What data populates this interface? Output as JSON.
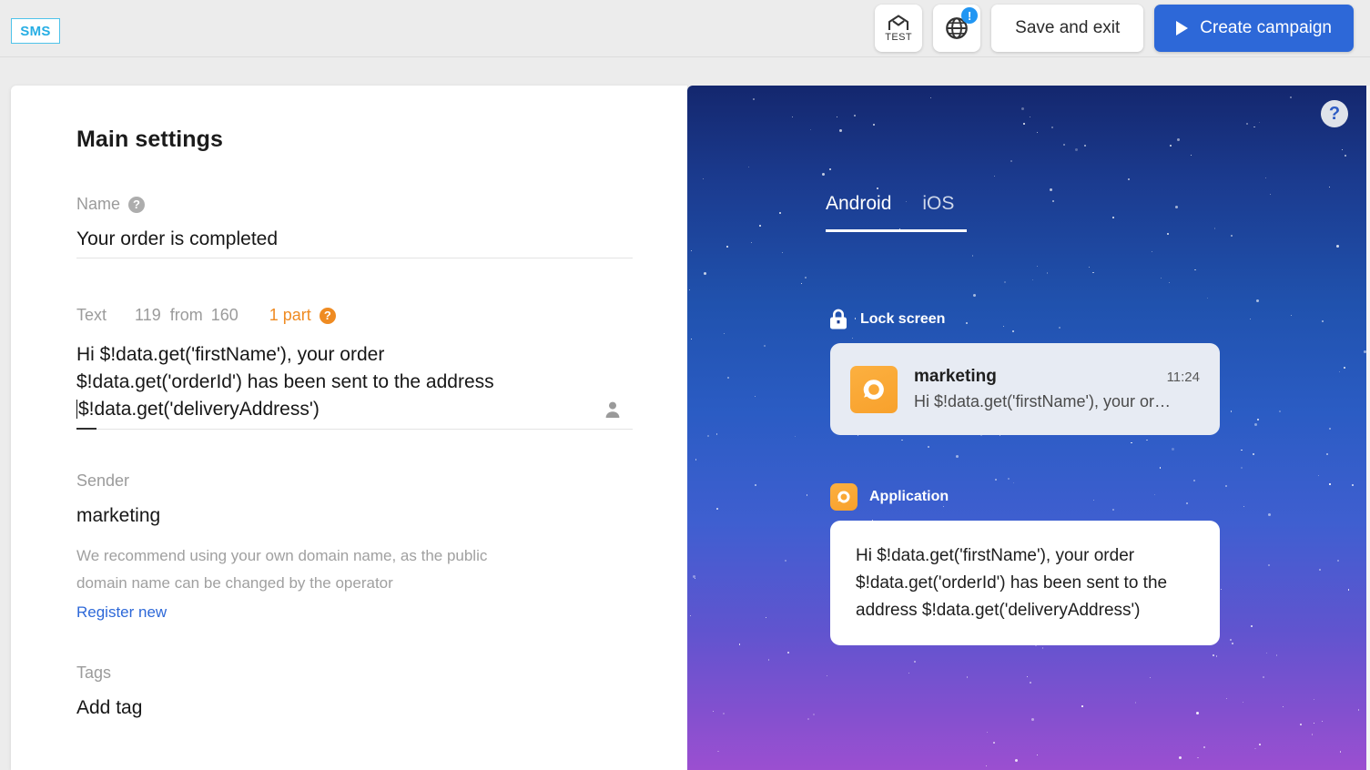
{
  "topbar": {
    "channel_badge": "SMS",
    "test_icon_label": "TEST",
    "test_icon_name": "home-envelope-test-icon",
    "globe_icon_name": "globe-icon",
    "globe_badge": "!",
    "save_exit_label": "Save and exit",
    "create_campaign_label": "Create campaign",
    "create_campaign_color": "#2d68d8"
  },
  "form": {
    "title": "Main settings",
    "name": {
      "label": "Name",
      "help": "?",
      "value": "Your order is completed"
    },
    "text": {
      "label": "Text",
      "count": "119",
      "from_word": "from",
      "limit": "160",
      "parts": "1 part",
      "parts_color": "#ef8b22",
      "help": "?",
      "value": "Hi $!data.get('firstName'), your order $!data.get('orderId') has been sent to the address $!data.get('deliveryAddress')",
      "line1": "Hi $!data.get('firstName'), your order",
      "line2": "$!data.get('orderId') has been sent to the address",
      "line3": "$!data.get('deliveryAddress')"
    },
    "sender": {
      "label": "Sender",
      "value": "marketing",
      "hint_line1": "We recommend using your own domain name, as the public",
      "hint_line2": "domain name can be changed by the operator",
      "register_link": "Register new"
    },
    "tags": {
      "label": "Tags",
      "placeholder": "Add tag"
    }
  },
  "preview": {
    "help_icon": "?",
    "tabs": [
      {
        "label": "Android",
        "active": true
      },
      {
        "label": "iOS",
        "active": false
      }
    ],
    "lock_screen": {
      "section_label": "Lock screen",
      "lock_icon_name": "lock-icon",
      "sender": "marketing",
      "time": "11:24",
      "body": "Hi $!data.get('firstName'), your or…"
    },
    "application": {
      "section_label": "Application",
      "app_icon_color": "#fcb040",
      "line1": "Hi $!data.get('firstName'), your order",
      "line2": "$!data.get('orderId') has been sent to the",
      "line3": "address $!data.get('deliveryAddress')"
    }
  }
}
